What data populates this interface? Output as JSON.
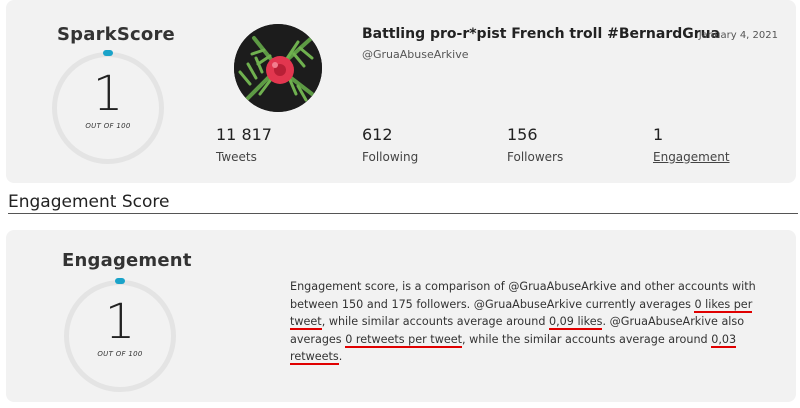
{
  "profile": {
    "score_title": "SparkScore",
    "score_value": "1",
    "score_caption": "OUT OF 100",
    "name": "Battling pro-r*pist French troll #BernardGrua",
    "date": "January 4, 2021",
    "handle": "@GruaAbuseArkive",
    "stats": [
      {
        "value": "11 817",
        "label": "Tweets"
      },
      {
        "value": "612",
        "label": "Following"
      },
      {
        "value": "156",
        "label": "Followers"
      },
      {
        "value": "1",
        "label": "Engagement"
      }
    ]
  },
  "section": {
    "title": "Engagement Score"
  },
  "engagement": {
    "title": "Engagement",
    "value": "1",
    "caption": "OUT OF 100",
    "text": {
      "p1": "Engagement score, is a comparison of @GruaAbuseArkive and other accounts with between 150 and 175 followers. @GruaAbuseArkive currently averages ",
      "h1": "0 likes per tweet",
      "p2": ", while similar accounts average around ",
      "h2": "0,09 likes",
      "p3": ". @GruaAbuseArkive also averages ",
      "h3": "0 retweets per tweet",
      "p4": ", while the similar accounts average around ",
      "h4": "0,03 retweets",
      "p5": "."
    }
  },
  "colors": {
    "accent": "#1aa3c9",
    "highlight": "#e00000",
    "card": "#f2f2f2"
  }
}
